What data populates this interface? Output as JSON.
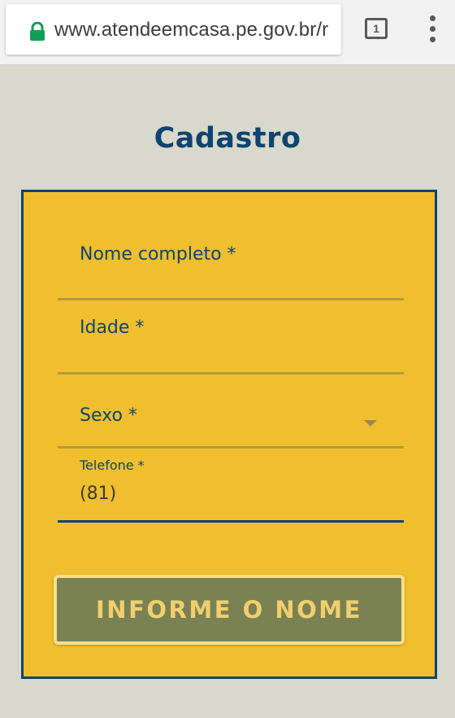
{
  "browser": {
    "url": "www.atendeemcasa.pe.gov.br/r",
    "tab_count": "1",
    "icons": {
      "lock": "lock-icon",
      "tabs": "tabs-switcher-icon",
      "menu": "more-vert-icon"
    },
    "colors": {
      "lock": "#109d58"
    }
  },
  "page": {
    "title": "Cadastro"
  },
  "form": {
    "fields": [
      {
        "label": "Nome completo *",
        "value": ""
      },
      {
        "label": "Idade *",
        "value": ""
      },
      {
        "label": "Sexo *",
        "value": "",
        "icon": "dropdown-arrow-icon"
      },
      {
        "label": "Telefone *",
        "value": "(81)"
      }
    ],
    "submit_label": "INFORME O NOME"
  },
  "colors": {
    "background": "#d9d8cc",
    "form_background": "#f0bf2d",
    "brand_blue": "#0d4470",
    "button_background": "#7a8254",
    "button_text": "#f0cf6f"
  }
}
